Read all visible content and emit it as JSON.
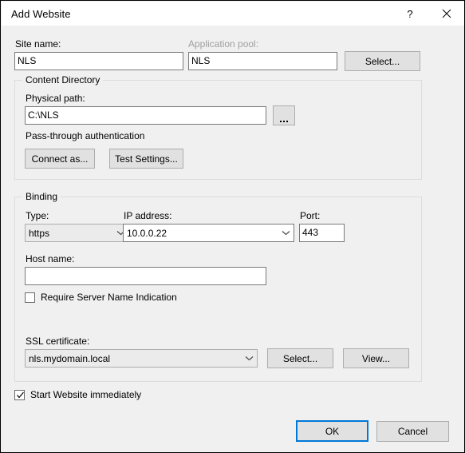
{
  "window": {
    "title": "Add Website",
    "help_button": "?",
    "close_button": "✕"
  },
  "site": {
    "name_label": "Site name:",
    "name_value": "NLS",
    "app_pool_label": "Application pool:",
    "app_pool_value": "NLS",
    "app_pool_select_button": "Select..."
  },
  "content_directory": {
    "group_title": "Content Directory",
    "physical_path_label": "Physical path:",
    "physical_path_value": "C:\\NLS",
    "browse_button": "...",
    "pass_through_text": "Pass-through authentication",
    "connect_as_button": "Connect as...",
    "test_settings_button": "Test Settings..."
  },
  "binding": {
    "group_title": "Binding",
    "type_label": "Type:",
    "type_value": "https",
    "ip_label": "IP address:",
    "ip_value": "10.0.0.22",
    "port_label": "Port:",
    "port_value": "443",
    "host_name_label": "Host name:",
    "host_name_value": "",
    "require_sni_label": "Require Server Name Indication",
    "require_sni_checked": false,
    "ssl_cert_label": "SSL certificate:",
    "ssl_cert_value": "nls.mydomain.local",
    "ssl_select_button": "Select...",
    "ssl_view_button": "View..."
  },
  "footer": {
    "start_website_label": "Start Website immediately",
    "start_website_checked": true,
    "ok_button": "OK",
    "cancel_button": "Cancel"
  },
  "colors": {
    "dialog_background": "#f0f0f0",
    "titlebar_background": "#ffffff",
    "accent": "#0078d7",
    "disabled_text": "#a0a0a0",
    "control_background": "#e1e1e1"
  }
}
